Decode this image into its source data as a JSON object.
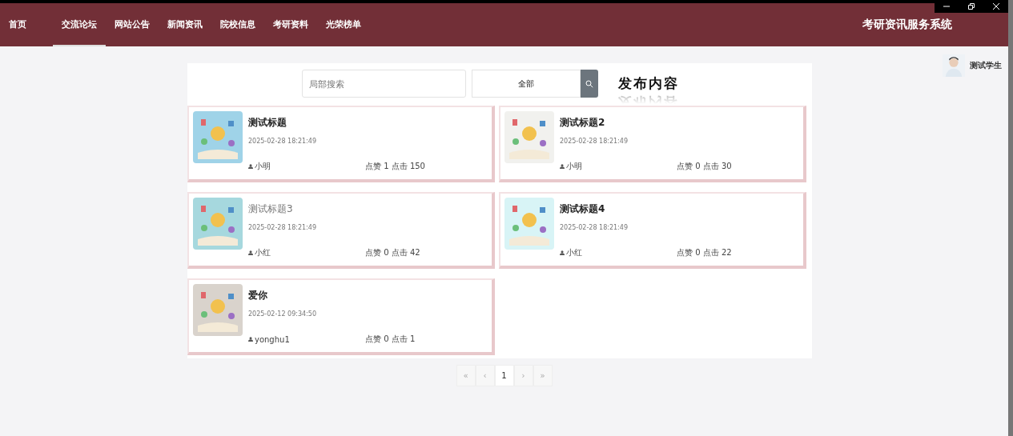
{
  "nav": {
    "items": [
      {
        "label": "首页",
        "selected": false
      },
      {
        "label": "交流论坛",
        "selected": true
      },
      {
        "label": "网站公告",
        "selected": false
      },
      {
        "label": "新闻资讯",
        "selected": false
      },
      {
        "label": "院校信息",
        "selected": false
      },
      {
        "label": "考研资料",
        "selected": false
      },
      {
        "label": "光荣榜单",
        "selected": false
      }
    ],
    "title": "考研资讯服务系统"
  },
  "user": {
    "name": "测试学生"
  },
  "search": {
    "placeholder": "局部搜索",
    "category": "全部",
    "publish": "发布内容"
  },
  "posts": [
    {
      "title": "测试标题",
      "time": "2025-02-28 18:21:49",
      "author": "小明",
      "stats": "点赞 1 点击 150",
      "hovered": false
    },
    {
      "title": "测试标题2",
      "time": "2025-02-28 18:21:49",
      "author": "小明",
      "stats": "点赞 0 点击 30",
      "hovered": false
    },
    {
      "title": "测试标题3",
      "time": "2025-02-28 18:21:49",
      "author": "小红",
      "stats": "点赞 0 点击 42",
      "hovered": true
    },
    {
      "title": "测试标题4",
      "time": "2025-02-28 18:21:49",
      "author": "小红",
      "stats": "点赞 0 点击 22",
      "hovered": false
    },
    {
      "title": "爱你",
      "time": "2025-02-12 09:34:50",
      "author": "yonghu1",
      "stats": "点赞 0 点击 1",
      "hovered": false
    }
  ],
  "pagination": [
    {
      "label": "«",
      "selected": false
    },
    {
      "label": "‹",
      "selected": false
    },
    {
      "label": "1",
      "selected": true
    },
    {
      "label": "›",
      "selected": false
    },
    {
      "label": "»",
      "selected": false
    }
  ]
}
